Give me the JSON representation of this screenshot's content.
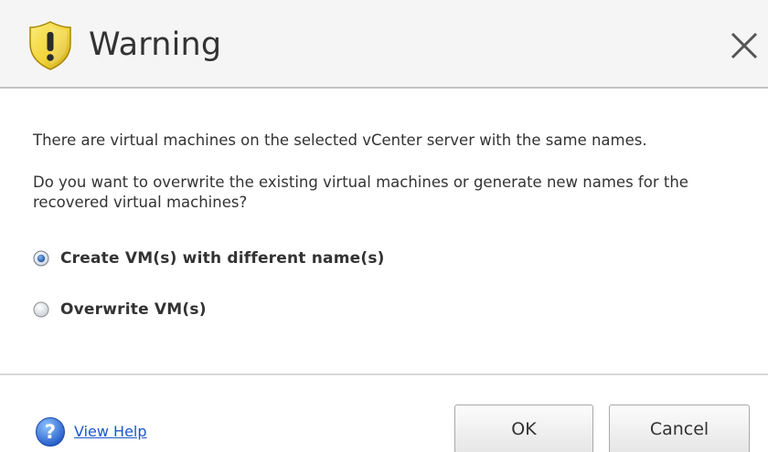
{
  "dialog": {
    "title": "Warning",
    "title_icon": "warning-shield-icon",
    "close_icon": "close-icon"
  },
  "message": {
    "line1": "There are virtual machines on the selected vCenter server with the same names.",
    "line2": "Do you want to overwrite the existing virtual machines or generate new names for the recovered virtual machines?"
  },
  "options": [
    {
      "label": "Create VM(s) with different name(s)",
      "selected": true
    },
    {
      "label": "Overwrite VM(s)",
      "selected": false
    }
  ],
  "footer": {
    "help_icon": "help-icon",
    "help_label": "View Help",
    "ok_label": "OK",
    "cancel_label": "Cancel"
  },
  "colors": {
    "link": "#1b58c9",
    "shield_yellow": "#f2d53a",
    "help_blue": "#2a6fd6"
  }
}
